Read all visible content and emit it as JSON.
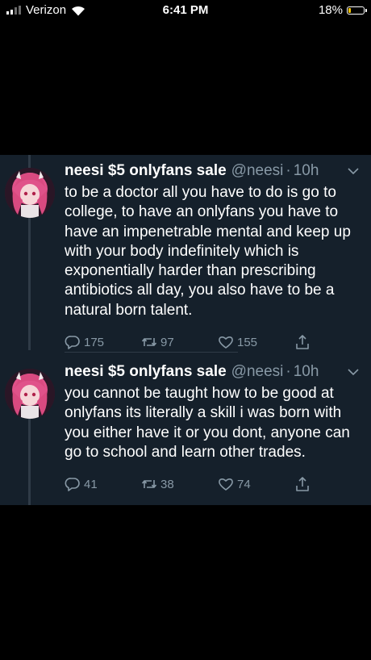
{
  "status_bar": {
    "carrier": "Verizon",
    "time": "6:41 PM",
    "battery_percent": "18%",
    "battery_level": 0.18,
    "battery_color": "#f5c400"
  },
  "tweets": [
    {
      "display_name": "neesi $5 onlyfans sale",
      "handle": "@neesi",
      "separator": "·",
      "time": "10h",
      "text": "to be a doctor all you have to do is go to college, to have an onlyfans you have to have an impenetrable mental and keep up with your body indefinitely which is exponentially harder than prescribing antibiotics all day, you also have to be a natural born talent.",
      "replies": "175",
      "retweets": "97",
      "likes": "155"
    },
    {
      "display_name": "neesi $5 onlyfans sale",
      "handle": "@neesi",
      "separator": "·",
      "time": "10h",
      "text": "you cannot be taught how to be good at onlyfans its literally a skill i was born with you either have it or you dont, anyone can go to school and learn other trades.",
      "replies": "41",
      "retweets": "38",
      "likes": "74"
    }
  ],
  "icons": [
    "signal-icon",
    "wifi-icon",
    "battery-icon",
    "chevron-down-icon",
    "reply-icon",
    "retweet-icon",
    "like-icon",
    "share-icon"
  ],
  "colors": {
    "background": "#15202b",
    "secondary_text": "#8899a6",
    "thread_line": "#2f3b47"
  }
}
